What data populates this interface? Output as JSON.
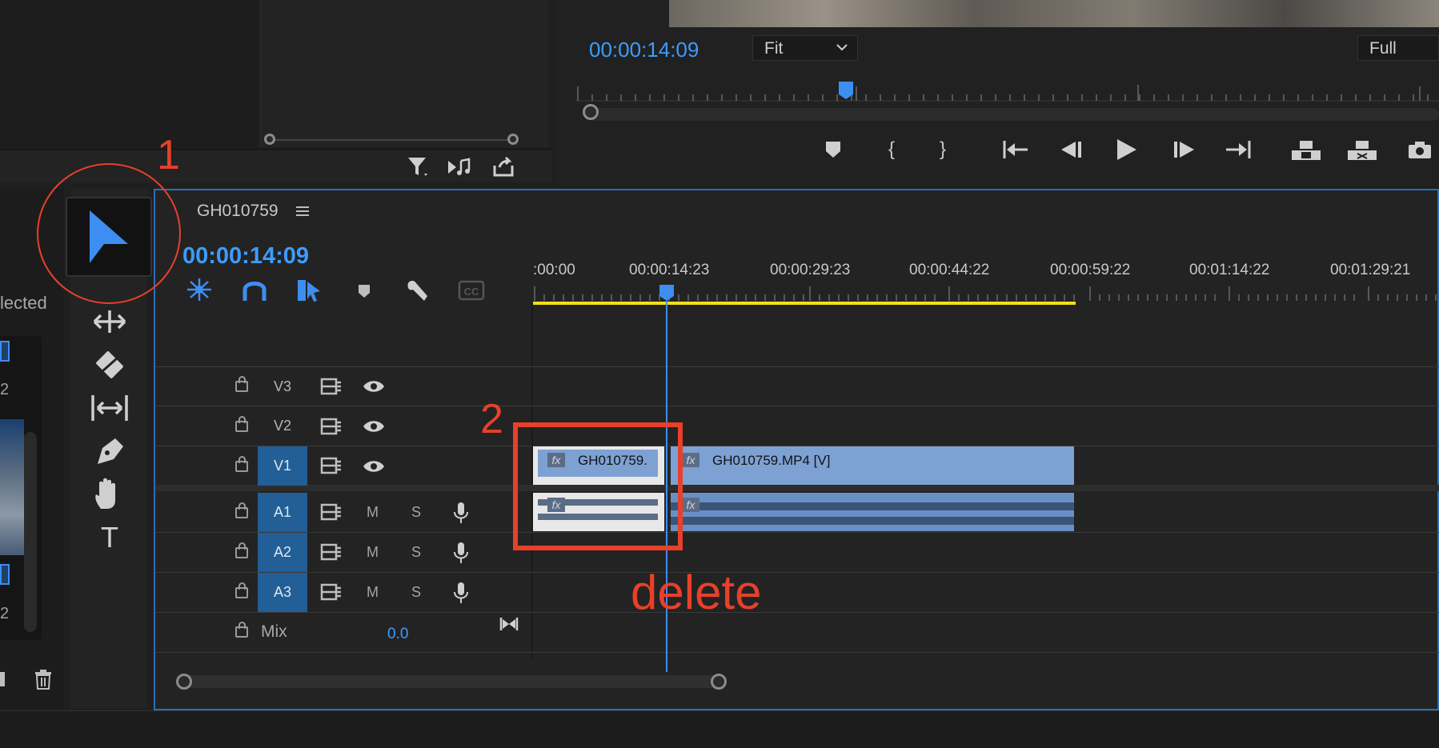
{
  "program_monitor": {
    "timecode": "00:00:14:09",
    "fit_select": "Fit",
    "quality_select": "Full"
  },
  "timeline": {
    "sequence_name": "GH010759",
    "menu_icon": "hamburger-icon",
    "timecode": "00:00:14:09",
    "ruler": [
      ":00:00",
      "00:00:14:23",
      "00:00:29:23",
      "00:00:44:22",
      "00:00:59:22",
      "00:01:14:22",
      "00:01:29:21"
    ],
    "tracks": {
      "v3": "V3",
      "v2": "V2",
      "v1": "V1",
      "a1": "A1",
      "a2": "A2",
      "a3": "A3",
      "mix": "Mix",
      "mix_value": "0.0"
    },
    "mute": "M",
    "solo": "S",
    "clips": {
      "v1_a": "GH010759.",
      "v1_b": "GH010759.MP4 [V]",
      "fx": "fx"
    }
  },
  "project_panel": {
    "partial_text": "lected",
    "partial_2a": "2",
    "partial_2b": "2"
  },
  "annotations": {
    "step1": "1",
    "step2": "2",
    "delete": "delete",
    "color": "#e8402a"
  },
  "colors": {
    "accent_blue": "#3d9cff",
    "selected_track": "#215f96",
    "clip_blue": "#7ea1d3",
    "yellow_work_area": "#f1e01b"
  }
}
